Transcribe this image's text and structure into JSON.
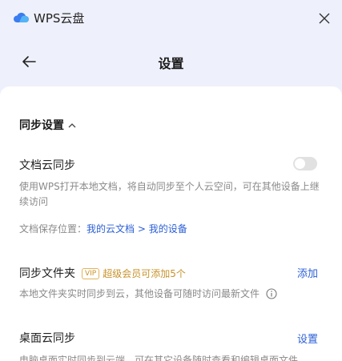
{
  "window": {
    "app_title": "WPS云盘",
    "icons": {
      "logo": "cloud-icon",
      "close": "close-icon"
    }
  },
  "header": {
    "title": "设置",
    "back_icon": "arrow-left-icon"
  },
  "sync_settings": {
    "section_title": "同步设置",
    "doc_cloud_sync": {
      "title": "文档云同步",
      "enabled": false,
      "description": "使用WPS打开本地文档，将自动同步至个人云空间，可在其他设备上继续访问",
      "save_location_label": "文档保存位置：",
      "save_location_path": "我的云文档 > 我的设备"
    },
    "sync_folder": {
      "title": "同步文件夹",
      "vip_badge": "VIP",
      "vip_text": "超级会员可添加5个",
      "action": "添加",
      "description": "本地文件夹实时同步到云，其他设备可随时访问最新文件"
    },
    "desktop_sync": {
      "title": "桌面云同步",
      "action": "设置",
      "description": "电脑桌面实时同步到云端，可在其它设备随时查看和编辑桌面文件"
    }
  },
  "colors": {
    "link": "#2b5fd6",
    "vip": "#c8932b",
    "header_bg": "#eef0fb",
    "card_bg": "#ffffff"
  }
}
